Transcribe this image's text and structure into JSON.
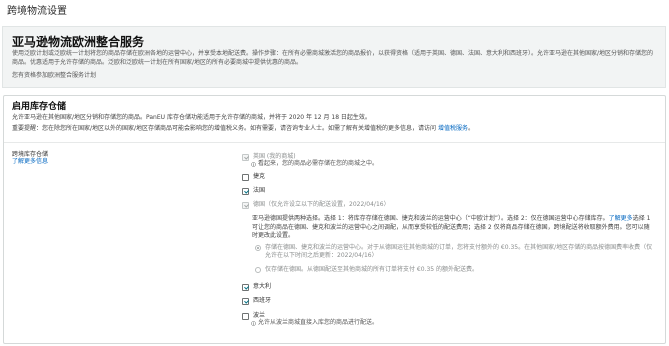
{
  "page": {
    "title": "跨境物流设置"
  },
  "eu_program": {
    "heading": "亚马逊物流欧洲整合服务",
    "description": "使用泛欧计划或泛欧统一计划将您的商品存储在欧洲各地的运营中心，并享受本地配送费。操作步骤：在所有必需商城激活您的商品报价，以获得资格（适用于英国、德国、法国、意大利和西班牙）。允许亚马逊在其他国家/地区分销和存储您的商品。优惠适用于允许存储的商品。泛欧和泛欧统一计划在所有国家/地区的所有必要商城中提供优惠的商品。",
    "eligibility": "您有资格参加欧洲整合服务计划"
  },
  "inventory_placement": {
    "heading": "启用库存仓储",
    "intro": "允许亚马逊在其他国家/地区分销和存储您的商品。PanEU 库存仓储功能适用于允许存储的商城，并将于 2020 年 12 月 18 日起生效。",
    "notice": "重要提醒：您在除您所在国家/地区以外的国家/地区存储商品可能会影响您的增值税义务。如有需要，请咨询专业人士。如需了解有关增值税的更多信息，请访问 ",
    "notice_link": "增值税服务",
    "notice_end": "。",
    "label": "跨境库存仓储",
    "learn_more": "了解更多信息",
    "note_icon": "info-icon",
    "marketplaces": [
      {
        "name": "英国 (我的商城)",
        "checked": true,
        "disabled": true,
        "note": "看起来，您的商品必需存储在您的商城之中。"
      },
      {
        "name": "捷克",
        "checked": false,
        "disabled": false
      },
      {
        "name": "法国",
        "checked": true,
        "disabled": false
      },
      {
        "name": "德国（仅允许设立以下的配送设置，2022/04/16）",
        "checked": true,
        "disabled": true
      },
      {
        "name": "意大利",
        "checked": true,
        "disabled": false
      },
      {
        "name": "西班牙",
        "checked": true,
        "disabled": false
      },
      {
        "name": "波兰",
        "checked": false,
        "disabled": false,
        "note": "允许从波兰商城直接入库您的商品进行配送。"
      }
    ],
    "germany_options": {
      "description": "亚马逊德国提供两种选择。选择 1：将库存存储在德国、捷克和波兰的运营中心（“中欧计划”）。选择 2：仅在德国运营中心存储库存。",
      "learn_more": "了解更多",
      "description_end": "选择 1 可让您的商品在德国、捷克和波兰的运营中心之间调配，从而享受较低的配送费用；选择 2 仅将商品存储在德国，跨境配送将收取额外费用。您可以随时更改此设置。",
      "choices": [
        {
          "text": "存储在德国、捷克和波兰的运营中心。对于从德国运往其他商城的订单，您将支付额外的 €0.35。在其他国家/地区存储的商品按德国费率收费（仅允许在以下时间之后更新：2022/04/16）",
          "selected": true,
          "disabled": true
        },
        {
          "text": "仅存储在德国。从德国配送至其他商城的所有订单将支付 €0.35 的额外配送费。",
          "selected": false,
          "disabled": true
        }
      ]
    }
  },
  "colors": {
    "link": "#0066c0",
    "check": "#007185",
    "panel_bg": "#f2f4f4",
    "text": "#333333"
  }
}
